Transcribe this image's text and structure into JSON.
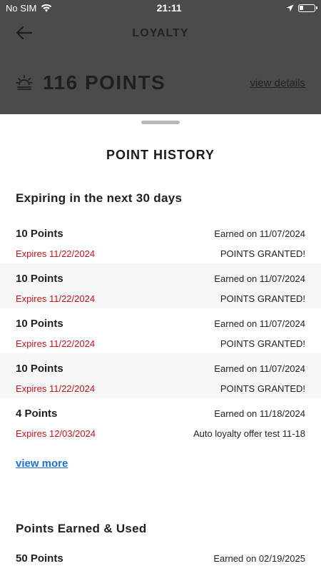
{
  "status_bar": {
    "carrier": "No SIM",
    "time": "21:11"
  },
  "header": {
    "title": "LOYALTY"
  },
  "points_summary": {
    "points_label": "116 POINTS",
    "view_details": "view details"
  },
  "sheet": {
    "title": "POINT HISTORY"
  },
  "expiring": {
    "title": "Expiring in the next 30 days",
    "rows": [
      {
        "points": "10 Points",
        "earned": "Earned on 11/07/2024",
        "expires": "Expires 11/22/2024",
        "reason": "POINTS GRANTED!"
      },
      {
        "points": "10 Points",
        "earned": "Earned on 11/07/2024",
        "expires": "Expires 11/22/2024",
        "reason": "POINTS GRANTED!"
      },
      {
        "points": "10 Points",
        "earned": "Earned on 11/07/2024",
        "expires": "Expires 11/22/2024",
        "reason": "POINTS GRANTED!"
      },
      {
        "points": "10 Points",
        "earned": "Earned on 11/07/2024",
        "expires": "Expires 11/22/2024",
        "reason": "POINTS GRANTED!"
      },
      {
        "points": "4 Points",
        "earned": "Earned on 11/18/2024",
        "expires": "Expires 12/03/2024",
        "reason": "Auto loyalty offer test 11-18"
      }
    ],
    "view_more": "view more"
  },
  "earned_used": {
    "title": "Points Earned & Used",
    "rows": [
      {
        "points": "50 Points",
        "earned": "Earned on 02/19/2025"
      }
    ]
  },
  "colors": {
    "expires_red": "#c2141c",
    "link_blue": "#1f6fd0",
    "overlay": "#4b4b4b"
  }
}
